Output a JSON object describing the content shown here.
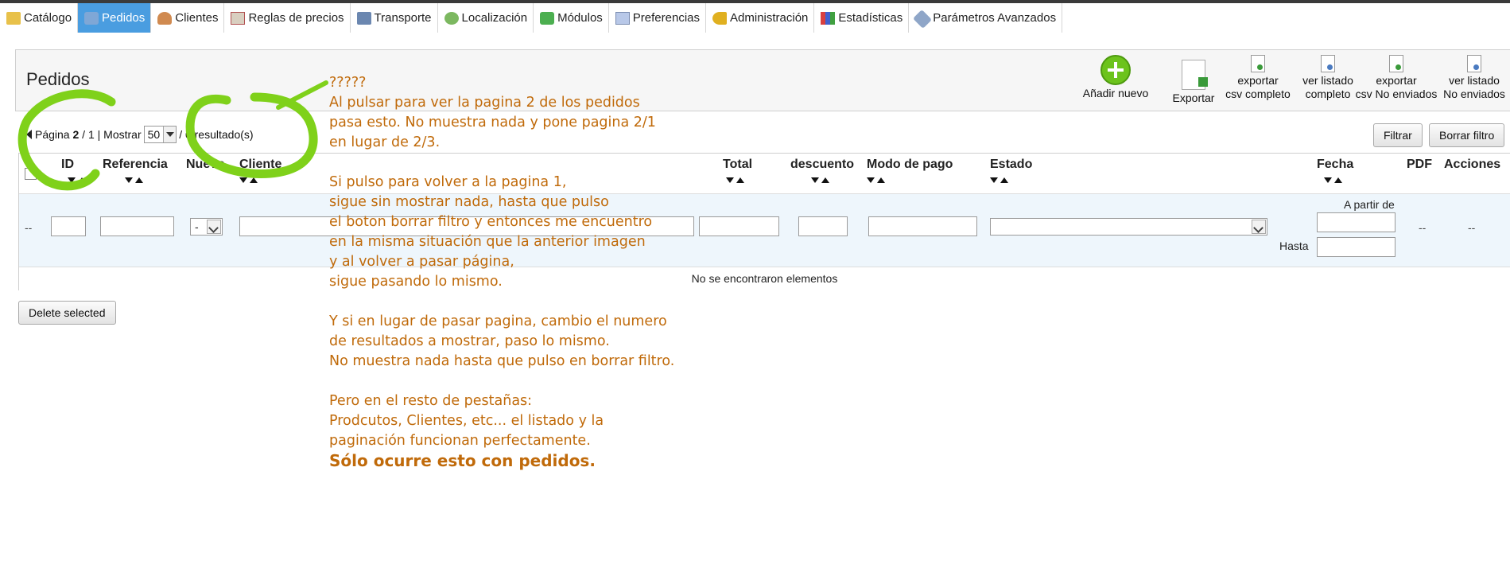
{
  "tabs": [
    {
      "label": "Catálogo",
      "icon": "folder-icon",
      "active": false
    },
    {
      "label": "Pedidos",
      "icon": "cart-icon",
      "active": true
    },
    {
      "label": "Clientes",
      "icon": "person-icon",
      "active": false
    },
    {
      "label": "Reglas de precios",
      "icon": "price-rules-icon",
      "active": false
    },
    {
      "label": "Transporte",
      "icon": "truck-icon",
      "active": false
    },
    {
      "label": "Localización",
      "icon": "globe-icon",
      "active": false
    },
    {
      "label": "Módulos",
      "icon": "puzzle-icon",
      "active": false
    },
    {
      "label": "Preferencias",
      "icon": "preferences-icon",
      "active": false
    },
    {
      "label": "Administración",
      "icon": "key-icon",
      "active": false
    },
    {
      "label": "Estadísticas",
      "icon": "chart-icon",
      "active": false
    },
    {
      "label": "Parámetros Avanzados",
      "icon": "wrench-icon",
      "active": false
    }
  ],
  "page_title": "Pedidos",
  "toolbar": {
    "add": "Añadir nuevo",
    "export": "Exportar",
    "export_csv_full": {
      "line1": "exportar",
      "line2": "csv completo"
    },
    "view_full": {
      "line1": "ver listado",
      "line2": "completo"
    },
    "export_csv_unsent": {
      "line1": "exportar",
      "line2": "csv No enviados"
    },
    "view_unsent": {
      "line1": "ver listado",
      "line2": "No enviados"
    }
  },
  "pager": {
    "page_label": "Página",
    "current_page": "2",
    "total_pages": "/ 1 |",
    "show_label": "Mostrar",
    "per_page": "50",
    "results": "/ 0 resultado(s)"
  },
  "buttons": {
    "filter": "Filtrar",
    "clear_filter": "Borrar filtro",
    "delete_selected": "Delete selected"
  },
  "columns": {
    "id": "ID",
    "reference": "Referencia",
    "new": "Nuevo",
    "customer": "Cliente",
    "total": "Total",
    "discount": "descuento",
    "payment": "Modo de pago",
    "status": "Estado",
    "date": "Fecha",
    "pdf": "PDF",
    "actions": "Acciones"
  },
  "filters": {
    "row_dash": "--",
    "new_value": "-",
    "date_from_label": "A partir de",
    "date_to_label": "Hasta",
    "pdf_dash": "--",
    "actions_dash": "--"
  },
  "empty_message": "No se encontraron elementos",
  "annotation": {
    "color": "#c06a0a",
    "circle_color": "#7fd11a",
    "lines": [
      "?????",
      "Al pulsar para ver la pagina 2 de los pedidos",
      "pasa esto. No muestra nada y pone pagina 2/1",
      "en lugar de 2/3.",
      "",
      "Si pulso para volver a la pagina 1,",
      "sigue sin mostrar nada, hasta que pulso",
      "el boton borrar filtro y entonces me encuentro",
      "en la misma situación que la anterior imagen",
      "y al volver a pasar página,",
      "sigue pasando lo mismo.",
      "",
      "Y si en lugar de pasar pagina, cambio el numero",
      "de resultados a mostrar, paso lo mismo.",
      "No muestra nada hasta que pulso en borrar filtro.",
      "",
      "Pero en el resto de pestañas:",
      "Prodcutos, Clientes, etc... el listado y la",
      "paginación funcionan perfectamente."
    ],
    "final_line": "Sólo ocurre esto con pedidos."
  }
}
